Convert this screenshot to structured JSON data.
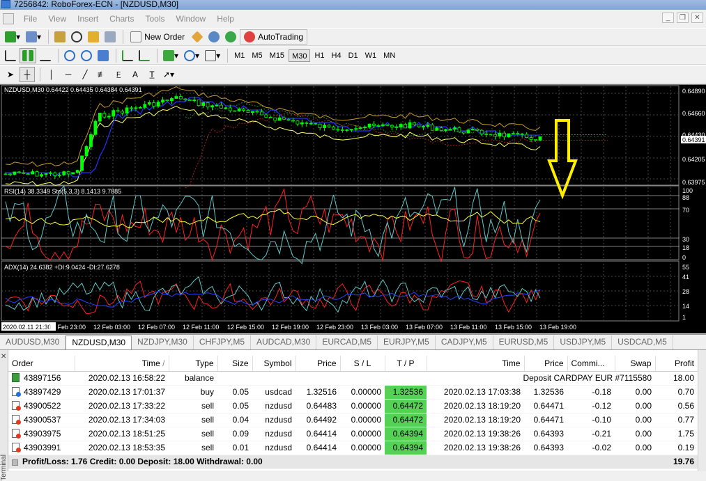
{
  "window": {
    "title": "7256842: RoboForex-ECN - [NZDUSD,M30]"
  },
  "menu": [
    "File",
    "View",
    "Insert",
    "Charts",
    "Tools",
    "Window",
    "Help"
  ],
  "toolbar": {
    "new_order": "New Order",
    "autotrading": "AutoTrading"
  },
  "timeframes": [
    "M1",
    "M5",
    "M15",
    "M30",
    "H1",
    "H4",
    "D1",
    "W1",
    "MN"
  ],
  "active_timeframe": "M30",
  "chart": {
    "main_label": "NZDUSD,M30  0.64422 0.64435 0.64384 0.64391",
    "rsi_label": "RSI(14) 38.3349  Sto(5,3,3) 8.1413 9.7885",
    "adx_label": "ADX(14) 24.6382 +DI:9.0424 -DI:27.6278",
    "price_levels": [
      "0.64890",
      "0.64660",
      "0.64430",
      "0.64391",
      "0.64205",
      "0.63975"
    ],
    "rsi_levels": [
      "100",
      "88",
      "70",
      "30",
      "18",
      "0"
    ],
    "adx_levels": [
      "55",
      "41",
      "28",
      "14",
      "1"
    ],
    "time_labels": [
      "2020.02.11 21:30",
      "12 Feb 23:00",
      "12 Feb 03:00",
      "12 Feb 07:00",
      "12 Feb 11:00",
      "12 Feb 15:00",
      "12 Feb 19:00",
      "12 Feb 23:00",
      "13 Feb 03:00",
      "13 Feb 07:00",
      "13 Feb 11:00",
      "13 Feb 15:00",
      "13 Feb 19:00"
    ],
    "colors": {
      "candle": "#00ff00",
      "bb": "#ffff66",
      "kijun": "#2233ff",
      "cloud_up": "#2e8b2e",
      "cloud_down": "#b22222",
      "arrow": "#ffee00"
    }
  },
  "symbol_tabs": [
    "AUDUSD,M30",
    "NZDUSD,M30",
    "NZDJPY,M30",
    "CHFJPY,M5",
    "AUDCAD,M30",
    "EURCAD,M5",
    "EURJPY,M5",
    "CADJPY,M5",
    "EURUSD,M5",
    "USDJPY,M5",
    "USDCAD,M5"
  ],
  "active_symbol_tab": "NZDUSD,M30",
  "terminal": {
    "columns": [
      "Order",
      "Time",
      "Type",
      "Size",
      "Symbol",
      "Price",
      "S / L",
      "T / P",
      "Time",
      "Price",
      "Commi...",
      "Swap",
      "Profit"
    ],
    "sort_marker": "/",
    "balance_row": {
      "order": "43897156",
      "time": "2020.02.13 16:58:22",
      "type": "balance",
      "comment": "Deposit CARDPAY EUR #7115580",
      "profit": "18.00"
    },
    "rows": [
      {
        "order": "43897429",
        "time": "2020.02.13 17:01:37",
        "type": "buy",
        "size": "0.05",
        "symbol": "usdcad",
        "price": "1.32516",
        "sl": "0.00000",
        "tp": "1.32536",
        "close_time": "2020.02.13 17:03:38",
        "close_price": "1.32536",
        "commission": "-0.18",
        "swap": "0.00",
        "profit": "0.70"
      },
      {
        "order": "43900522",
        "time": "2020.02.13 17:33:22",
        "type": "sell",
        "size": "0.05",
        "symbol": "nzdusd",
        "price": "0.64483",
        "sl": "0.00000",
        "tp": "0.64472",
        "close_time": "2020.02.13 18:19:20",
        "close_price": "0.64471",
        "commission": "-0.12",
        "swap": "0.00",
        "profit": "0.56"
      },
      {
        "order": "43900537",
        "time": "2020.02.13 17:34:03",
        "type": "sell",
        "size": "0.04",
        "symbol": "nzdusd",
        "price": "0.64492",
        "sl": "0.00000",
        "tp": "0.64472",
        "close_time": "2020.02.13 18:19:20",
        "close_price": "0.64471",
        "commission": "-0.10",
        "swap": "0.00",
        "profit": "0.77"
      },
      {
        "order": "43903975",
        "time": "2020.02.13 18:51:25",
        "type": "sell",
        "size": "0.09",
        "symbol": "nzdusd",
        "price": "0.64414",
        "sl": "0.00000",
        "tp": "0.64394",
        "close_time": "2020.02.13 19:38:26",
        "close_price": "0.64393",
        "commission": "-0.21",
        "swap": "0.00",
        "profit": "1.75"
      },
      {
        "order": "43903991",
        "time": "2020.02.13 18:53:35",
        "type": "sell",
        "size": "0.01",
        "symbol": "nzdusd",
        "price": "0.64414",
        "sl": "0.00000",
        "tp": "0.64394",
        "close_time": "2020.02.13 19:38:26",
        "close_price": "0.64393",
        "commission": "-0.02",
        "swap": "0.00",
        "profit": "0.19"
      }
    ],
    "summary": {
      "text": "Profit/Loss: 1.76  Credit: 0.00  Deposit: 18.00  Withdrawal: 0.00",
      "total": "19.76"
    },
    "side_label": "Terminal"
  }
}
